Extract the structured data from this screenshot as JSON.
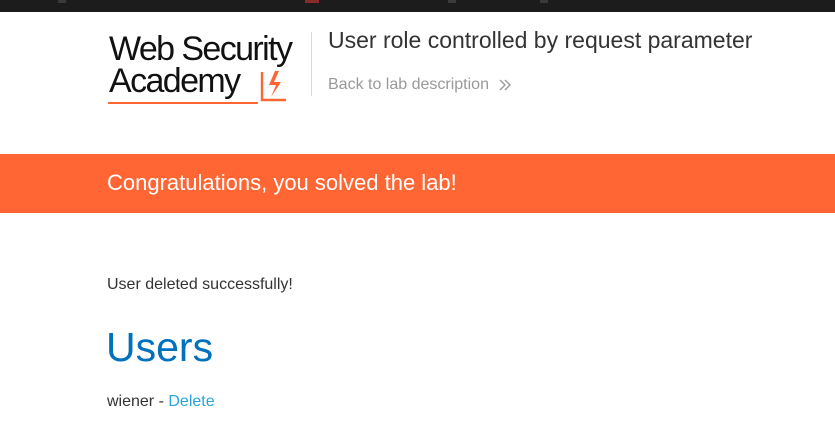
{
  "colors": {
    "brand_orange": "#ff6633",
    "link_blue": "#29a3d9",
    "heading_blue": "#0071bc",
    "text_dark": "#333333",
    "text_muted": "#999999"
  },
  "header": {
    "logo_line1": "Web Security",
    "logo_line2": "Academy",
    "logo_icon": "lightning-bolt-icon",
    "lab_title": "User role controlled by request parameter",
    "back_link_label": "Back to lab description",
    "back_link_icon": "double-chevron-right-icon"
  },
  "banner": {
    "text": "Congratulations, you solved the lab!"
  },
  "main": {
    "status_message": "User deleted successfully!",
    "heading": "Users",
    "users": [
      {
        "name": "wiener",
        "separator": " - ",
        "action_label": "Delete"
      }
    ]
  }
}
